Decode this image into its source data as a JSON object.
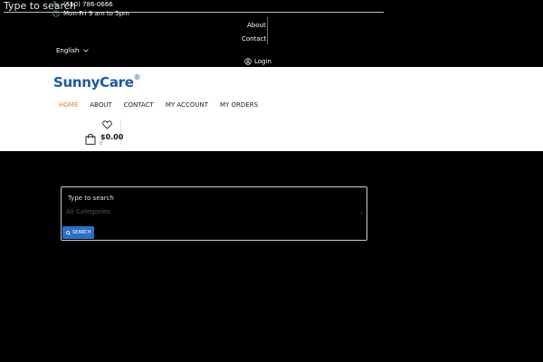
{
  "top_bar": {
    "search_placeholder": "Type to search",
    "phone": "(510) 786-0666",
    "hours": "Mon-Fri 9 am to 5pm",
    "links": {
      "about": "About",
      "contact": "Contact"
    },
    "language": "English",
    "login": "Login"
  },
  "header": {
    "logo_text": "SunnyCare",
    "logo_mark": "®",
    "nav": [
      {
        "label": "HOME",
        "active": true
      },
      {
        "label": "ABOUT"
      },
      {
        "label": "CONTACT"
      },
      {
        "label": "MY ACCOUNT"
      },
      {
        "label": "MY ORDERS"
      }
    ],
    "cart": {
      "total": "$0.00",
      "count": "0"
    }
  },
  "search_panel": {
    "placeholder": "Type to search",
    "category": "All Categories",
    "button": "SEARCH"
  },
  "colors": {
    "accent": "#e67e22",
    "brand": "#1a58a8",
    "button": "#2b72c7",
    "background": "#000000"
  },
  "icons": [
    "phone-icon",
    "clock-icon",
    "chevron-down-icon",
    "user-icon",
    "heart-icon",
    "shopping-bag-icon",
    "search-icon"
  ]
}
